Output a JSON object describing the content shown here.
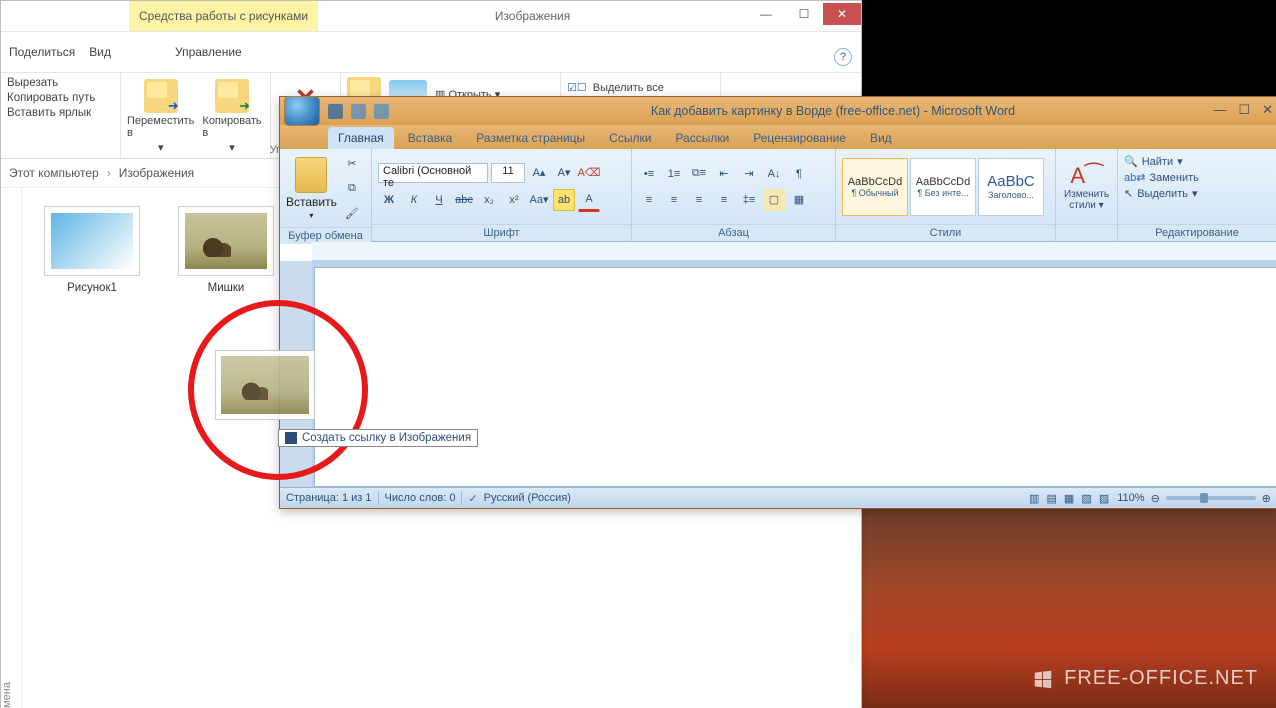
{
  "explorer": {
    "tools_tab": "Средства работы с рисунками",
    "title": "Изображения",
    "top_tabs": {
      "share": "Поделиться",
      "view": "Вид",
      "manage": "Управление"
    },
    "clipboard": {
      "cut": "Вырезать",
      "copy_path": "Копировать путь",
      "paste_shortcut": "Вставить ярлык"
    },
    "organize": {
      "move_to": "Переместить в",
      "copy_to": "Копировать в",
      "label": "Упорядо"
    },
    "open": {
      "open": "Открыть",
      "select_all": "Выделить все"
    },
    "breadcrumb": {
      "root": "Этот компьютер",
      "folder": "Изображения"
    },
    "nav_label": "мена",
    "files": [
      {
        "name": "Рисунок1"
      },
      {
        "name": "Мишки"
      }
    ]
  },
  "word": {
    "title": "Как добавить картинку в Ворде (free-office.net) - Microsoft Word",
    "tabs": {
      "home": "Главная",
      "insert": "Вставка",
      "layout": "Разметка страницы",
      "links": "Ссылки",
      "mail": "Рассылки",
      "review": "Рецензирование",
      "view": "Вид"
    },
    "groups": {
      "clipboard": "Буфер обмена",
      "paste": "Вставить",
      "font": "Шрифт",
      "font_name": "Calibri (Основной те",
      "font_size": "11",
      "paragraph": "Абзац",
      "styles": "Стили",
      "style_normal_prev": "AaBbCcDd",
      "style_normal_lbl": "¶ Обычный",
      "style_nospace_prev": "AaBbCcDd",
      "style_nospace_lbl": "¶ Без инте...",
      "style_h1_prev": "AaBbC",
      "style_h1_lbl": "Заголово...",
      "change_styles": "Изменить стили",
      "editing": "Редактирование",
      "find": "Найти",
      "replace": "Заменить",
      "select": "Выделить"
    },
    "status": {
      "page": "Страница: 1 из 1",
      "words": "Число слов: 0",
      "lang": "Русский (Россия)",
      "zoom": "110%"
    }
  },
  "drag": {
    "tip": "Создать ссылку в Изображения"
  },
  "watermark": "FREE-OFFICE.NET"
}
